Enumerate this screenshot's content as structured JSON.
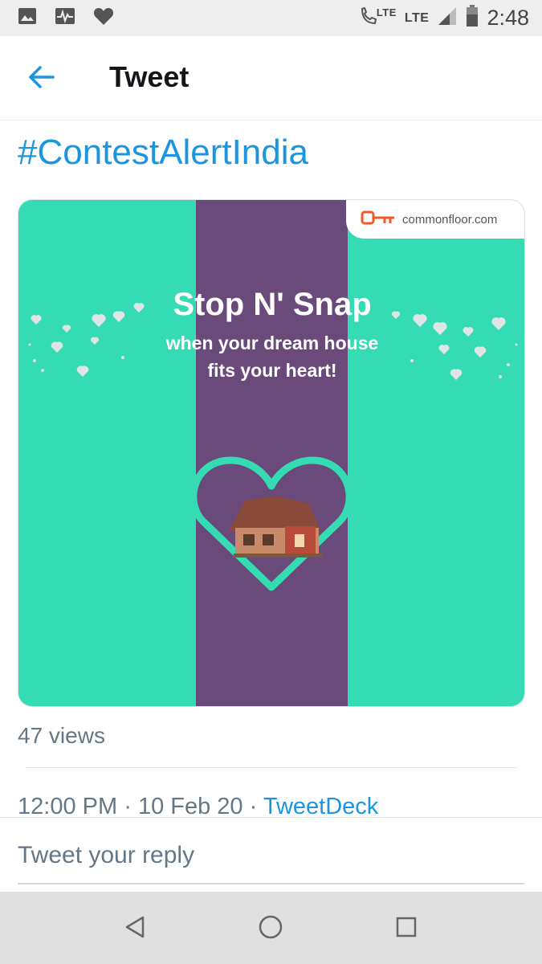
{
  "status_bar": {
    "network_1": "LTE",
    "network_2": "LTE",
    "time": "2:48",
    "icons": [
      "image-icon",
      "pulse-icon",
      "heart-icon",
      "call-lte-icon",
      "signal-icon",
      "battery-icon"
    ]
  },
  "header": {
    "title": "Tweet",
    "back_icon": "back-arrow-icon"
  },
  "tweet": {
    "hashtag": "#ContestAlertIndia",
    "media": {
      "brand": "commonfloor.com",
      "title": "Stop N' Snap",
      "subtitle_line1": "when your dream house",
      "subtitle_line2": "fits your heart!"
    },
    "views": "47 views",
    "time": "12:00 PM",
    "separator": "·",
    "date": "10 Feb 20",
    "source": "TweetDeck"
  },
  "reply": {
    "placeholder": "Tweet your reply"
  },
  "nav": {
    "icons": [
      "nav-back-icon",
      "nav-home-icon",
      "nav-recents-icon"
    ]
  },
  "colors": {
    "accent": "#1b95e0",
    "media_green": "#35dbb3",
    "media_purple": "#6a4a7a"
  }
}
